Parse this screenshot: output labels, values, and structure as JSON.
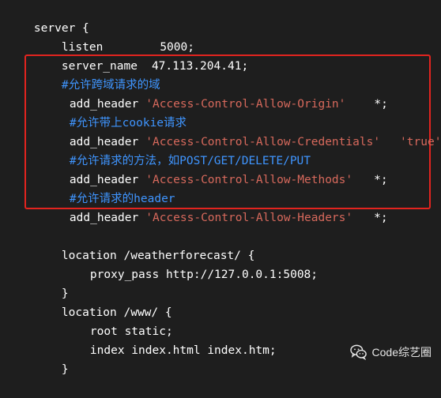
{
  "code": {
    "l1": "server {",
    "l2_key": "listen",
    "l2_val": "5000;",
    "l3_key": "server_name",
    "l3_val": "47.113.204.41;",
    "l4_comment": "#允许跨域请求的域",
    "l5_key": "add_header",
    "l5_str": "'Access-Control-Allow-Origin'",
    "l5_val": "*;",
    "l6_comment": "#允许带上cookie请求",
    "l7_key": "add_header",
    "l7_str": "'Access-Control-Allow-Credentials'",
    "l7_val": "'true';",
    "l8_comment": "#允许请求的方法，如POST/GET/DELETE/PUT",
    "l9_key": "add_header",
    "l9_str": "'Access-Control-Allow-Methods'",
    "l9_val": "*;",
    "l10_comment": "#允许请求的header",
    "l11_key": "add_header",
    "l11_str": "'Access-Control-Allow-Headers'",
    "l11_val": "*;",
    "l13": "location /weatherforecast/ {",
    "l14": "proxy_pass http://127.0.0.1:5008;",
    "l15": "}",
    "l16": "location /www/ {",
    "l17": "root static;",
    "l18": "index index.html index.htm;",
    "l19": "}"
  },
  "watermark": {
    "text": "Code综艺圈",
    "icon": "wechat-icon"
  },
  "colors": {
    "background": "#1e1e1e",
    "string": "#d7695c",
    "comment": "#3f95ff",
    "highlight_border": "#e2241f"
  }
}
